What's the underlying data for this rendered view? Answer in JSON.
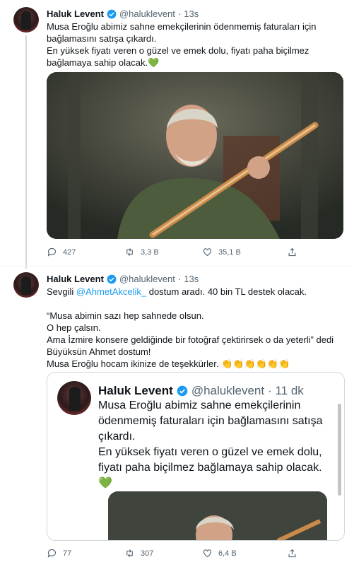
{
  "tweet1": {
    "name": "Haluk Levent",
    "handle": "@haluklevent",
    "time": "13s",
    "text": "Musa Eroğlu abimiz sahne emekçilerinin ödenmemiş faturaları için bağlamasını satışa çıkardı.\nEn yüksek fiyatı veren o güzel ve emek dolu, fiyatı paha biçilmez bağlamaya sahip olacak.💚",
    "replies": "427",
    "retweets": "3,3 B",
    "likes": "35,1 B"
  },
  "tweet2": {
    "name": "Haluk Levent",
    "handle": "@haluklevent",
    "time": "13s",
    "text_before_mention": "Sevgili ",
    "mention": "@AhmetAkcelik_",
    "text_after_mention": " dostum aradı. 40 bin TL destek olacak.",
    "body": "“Musa abimin sazı hep sahnede olsun.\nO hep çalsın.\nAma İzmire konsere geldiğinde bir fotoğraf çektirirsek o da yeterli” dedi\nBüyüksün Ahmet dostum!\nMusa Eroğlu hocam ikinize de teşekkürler. 👏👏👏👏👏👏",
    "replies": "77",
    "retweets": "307",
    "likes": "6,4 B"
  },
  "quote": {
    "name": "Haluk Levent",
    "handle": "@haluklevent",
    "time": "· 11 dk",
    "text": "Musa Eroğlu abimiz sahne emekçilerinin ödenmemiş faturaları için bağlamasını satışa çıkardı.\nEn yüksek fiyatı veren o güzel ve emek dolu, fiyatı paha biçilmez bağlamaya sahip olacak.💚"
  },
  "colors": {
    "accent": "#1d9bf0",
    "muted": "#536471",
    "border": "#cfd9de"
  }
}
